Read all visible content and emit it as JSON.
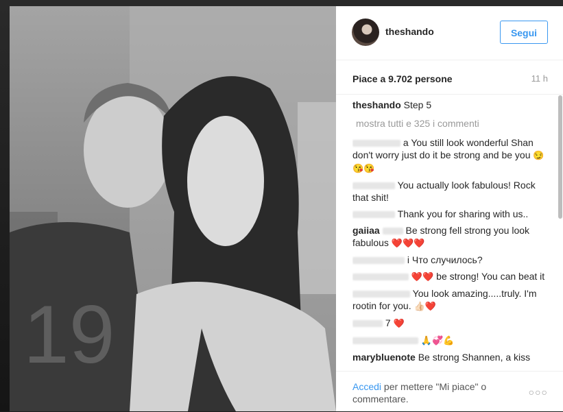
{
  "post": {
    "username": "theshando",
    "follow_label": "Segui",
    "likes": "Piace a 9.702 persone",
    "time": "11 h",
    "caption_user": "theshando",
    "caption_text": "Step 5",
    "show_all": "mostra tutti e 325 i commenti"
  },
  "comments": [
    {
      "text": "a You still look wonderful Shan don't worry just do it be strong and be you",
      "emoji": "😏😘😘"
    },
    {
      "text": "You actually look fabulous! Rock that shit!",
      "emoji": ""
    },
    {
      "text": "Thank you for sharing with us..",
      "emoji": ""
    },
    {
      "user": "gaiiaa",
      "text": "Be strong fell strong you look fabulous",
      "emoji": "❤️❤️❤️"
    },
    {
      "text": "i Что случилось?",
      "emoji": ""
    },
    {
      "text": "be strong! You can beat it",
      "emoji_before": "❤️❤️"
    },
    {
      "text": "You look amazing.....truly. I'm rootin for you.",
      "emoji": "👍🏻❤️"
    },
    {
      "text": "7",
      "emoji": "❤️"
    },
    {
      "text": "",
      "emoji": "🙏💞💪"
    },
    {
      "user": "marybluenote",
      "text": "Be strong Shannen, a kiss"
    }
  ],
  "footer": {
    "login_link": "Accedi",
    "login_text": "per mettere \"Mi piace\" o commentare.",
    "more_label": "○○○"
  },
  "colors": {
    "accent": "#3897f0",
    "text": "#262626",
    "muted": "#999999"
  }
}
